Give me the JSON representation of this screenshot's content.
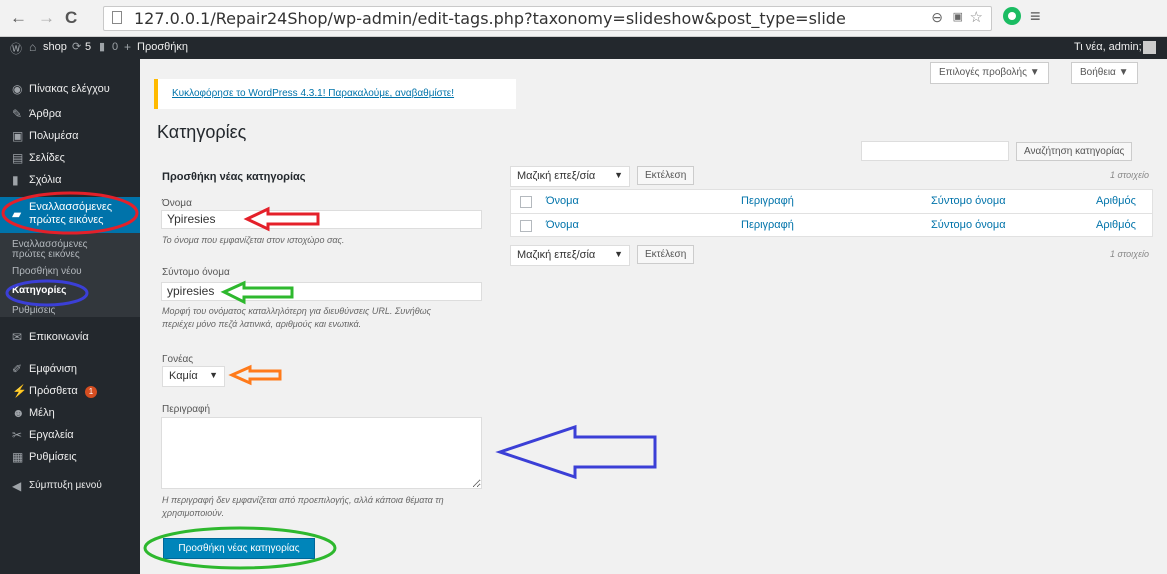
{
  "browser": {
    "back": "←",
    "forward": "→",
    "reload": "C",
    "url": "127.0.0.1/Repair24Shop/wp-admin/edit-tags.php?taxonomy=slideshow&post_type=slide",
    "icons": [
      "zoom-icon",
      "translate-icon",
      "star-icon",
      "extension-icon",
      "menu-icon"
    ]
  },
  "adminbar": {
    "site": "shop",
    "updates": "5",
    "comments": "0",
    "new": "Προσθήκη",
    "greeting": "Τι νέα, admin;"
  },
  "sidebar": {
    "items": [
      {
        "label": "Πίνακας ελέγχου",
        "icon": "dashboard-icon"
      },
      {
        "label": "Άρθρα",
        "icon": "pin-icon"
      },
      {
        "label": "Πολυμέσα",
        "icon": "media-icon"
      },
      {
        "label": "Σελίδες",
        "icon": "page-icon"
      },
      {
        "label": "Σχόλια",
        "icon": "comment-icon"
      }
    ],
    "active_line1": "Εναλλασσόμενες",
    "active_line2": "πρώτες εικόνες",
    "sub_line1": "Εναλλασσόμενες",
    "sub_line2": "πρώτες εικόνες",
    "sub_add": "Προσθήκη νέου",
    "sub_categories": "Κατηγορίες",
    "sub_settings": "Ρυθμίσεις",
    "after": [
      {
        "label": "Επικοινωνία",
        "icon": "mail-icon"
      },
      {
        "label": "Εμφάνιση",
        "icon": "brush-icon"
      },
      {
        "label": "Πρόσθετα",
        "icon": "plugin-icon",
        "badge": "1"
      },
      {
        "label": "Μέλη",
        "icon": "user-icon"
      },
      {
        "label": "Εργαλεία",
        "icon": "wrench-icon"
      },
      {
        "label": "Ρυθμίσεις",
        "icon": "settings-icon"
      },
      {
        "label": "Σύμπτυξη μενού",
        "icon": "collapse-icon"
      }
    ]
  },
  "top": {
    "screen_options": "Επιλογές προβολής ▼",
    "help": "Βοήθεια ▼"
  },
  "notice": "Κυκλοφόρησε το WordPress 4.3.1! Παρακαλούμε, αναβαθμίστε!",
  "title": "Κατηγορίες",
  "search": {
    "button": "Αναζήτηση κατηγορίας",
    "value": ""
  },
  "form": {
    "heading": "Προσθήκη νέας κατηγορίας",
    "name_label": "Όνομα",
    "name_value": "Ypiresies",
    "name_desc": "Το όνομα που εμφανίζεται στον ιστοχώρο σας.",
    "slug_label": "Σύντομο όνομα",
    "slug_value": "ypiresies",
    "slug_desc_1": "Μορφή του ονόματος καταλληλότερη για διευθύνσεις URL. Συνήθως",
    "slug_desc_2": "περιέχει μόνο πεζά λατινικά, αριθμούς και ενωτικά.",
    "parent_label": "Γονέας",
    "parent_value": "Καμία",
    "desc_label": "Περιγραφή",
    "desc_value": "",
    "desc_help_1": "Η περιγραφή δεν εμφανίζεται από προεπιλογής, αλλά κάποια θέματα τη",
    "desc_help_2": "χρησιμοποιούν.",
    "submit": "Προσθήκη νέας κατηγορίας"
  },
  "table": {
    "bulk": "Μαζική επεξ/σία",
    "apply": "Εκτέλεση",
    "count": "1 στοιχείο",
    "cols": [
      "Όνομα",
      "Περιγραφή",
      "Σύντομο όνομα",
      "Αριθμός"
    ]
  },
  "annotations": {
    "red": "#e4202a",
    "blue": "#3b3fd6",
    "green": "#2eb82e",
    "orange": "#ff7a1a"
  }
}
